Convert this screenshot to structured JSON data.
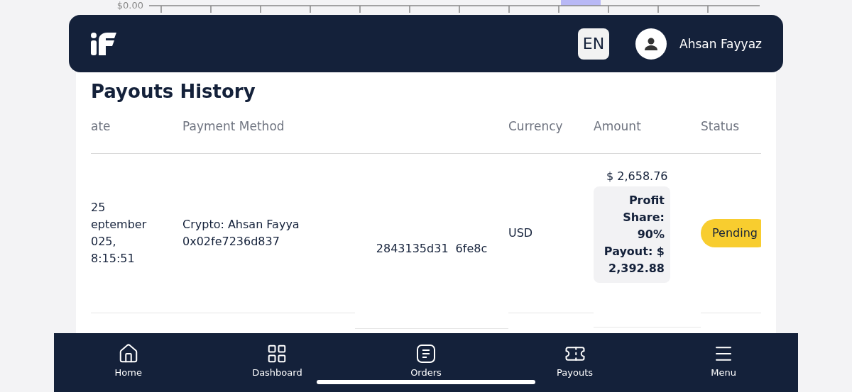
{
  "chart_strip": {
    "y_tick": "$0.00"
  },
  "header": {
    "language": "EN",
    "user_name": "Ahsan Fayyaz"
  },
  "title": "Payouts History",
  "table": {
    "columns": [
      "ate",
      "Payment Method",
      "Currency",
      "Amount",
      "Status"
    ],
    "rows": [
      {
        "date_lines": [
          "25",
          "eptember",
          "025,",
          "8:15:51"
        ],
        "method_line": "Crypto: Ahsan Fayya",
        "address_parts": [
          "0x02fe7236d837",
          "2843135d31",
          "6fe8c"
        ],
        "currency": "USD",
        "amount": "$ 2,658.76",
        "profit_share": "Profit Share: 90%",
        "payout": "Payout: $ 2,392.88",
        "status": {
          "label": "Pending",
          "kind": "pending"
        }
      }
    ]
  },
  "bottom_nav": [
    {
      "label": "Home",
      "kind": "home"
    },
    {
      "label": "Dashboard",
      "kind": "grid"
    },
    {
      "label": "Orders",
      "kind": "orders"
    },
    {
      "label": "Payouts",
      "kind": "ticket"
    },
    {
      "label": "Menu",
      "kind": "menu"
    }
  ]
}
